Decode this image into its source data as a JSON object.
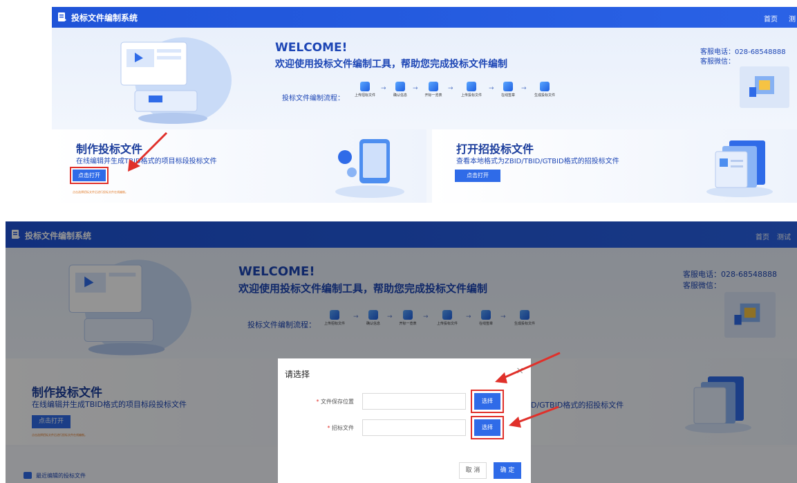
{
  "app": {
    "title": "投标文件编制系统",
    "nav_home": "首页",
    "nav_user_p1": "测",
    "nav_user_p2": "测试"
  },
  "banner": {
    "welcome": "WELCOME!",
    "subtitle": "欢迎使用投标文件编制工具，帮助您完成投标文件编制",
    "flow_label": "投标文件编制流程：",
    "steps": [
      "上传招标文件",
      "确认信息",
      "开标一览表",
      "上传投标文件",
      "在线签章",
      "生成投标文件"
    ],
    "arrow": "→",
    "service_phone": "客服电话：028-68548888",
    "service_wechat": "客服微信："
  },
  "cards": {
    "make": {
      "title": "制作投标文件",
      "desc": "在线编辑并生成TBID格式的项目标段投标文件",
      "button": "点击打开",
      "note": "点击选择招标文件后进行投标文件在线编制。"
    },
    "open": {
      "title": "打开招投标文件",
      "desc": "查看本地格式为ZBID/TBID/GTBID格式的招投标文件",
      "desc_partial": "D/GTBID格式的招投标文件",
      "button": "点击打开"
    }
  },
  "recent": {
    "label": "最近编辑的投标文件"
  },
  "dialog": {
    "title": "请选择",
    "close": "×",
    "required_mark": "*",
    "field1_label": "文件保存位置",
    "field2_label": "招标文件",
    "pick_button": "选择",
    "cancel": "取 消",
    "ok": "确 定"
  },
  "colors": {
    "brand": "#2f6be8",
    "header": "#1f54d8",
    "annotation_red": "#e0302a"
  }
}
